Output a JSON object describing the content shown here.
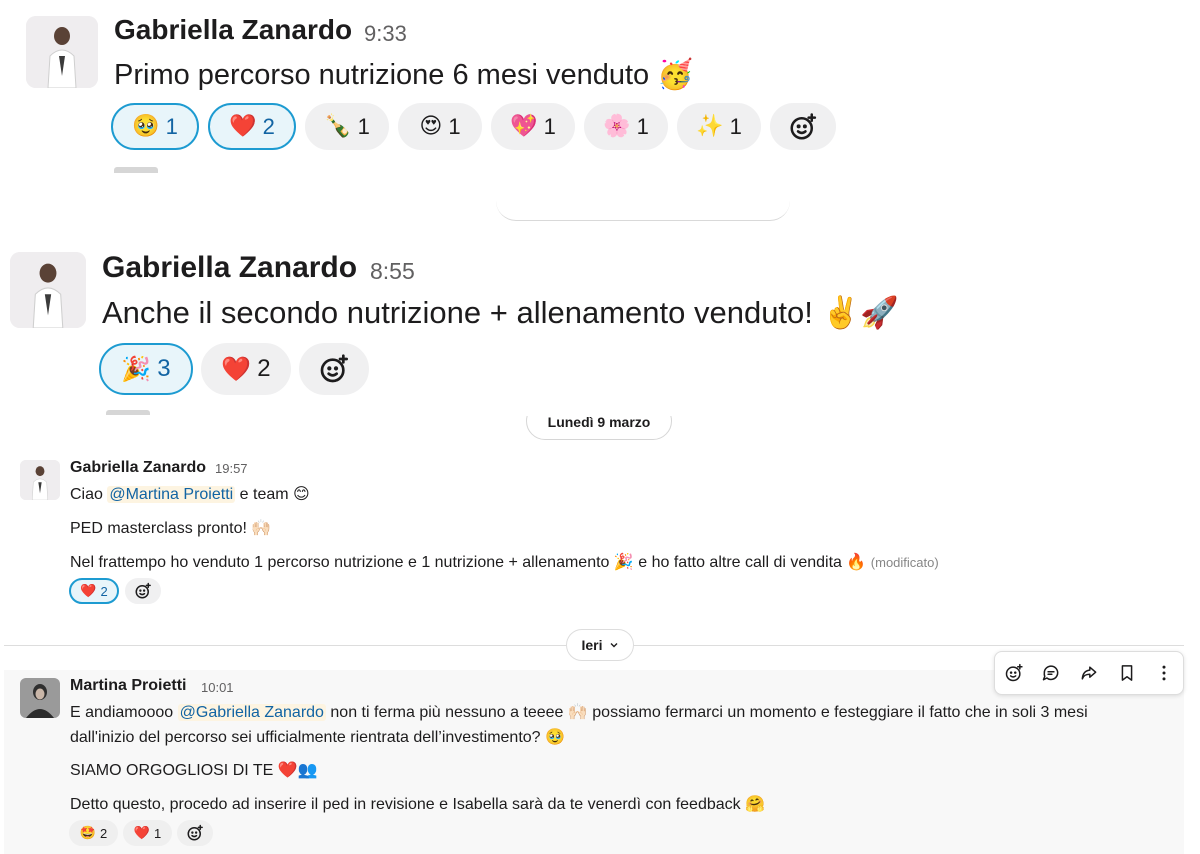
{
  "colors": {
    "accent": "#1264a3",
    "selected_border": "#1d9bd1",
    "selected_bg": "#e8f5fa",
    "reaction_bg": "#f0f0f1",
    "hover_bg": "#f8f8f8"
  },
  "msg1": {
    "author": "Gabriella Zanardo",
    "time": "9:33",
    "text": "Primo percorso nutrizione 6 mesi venduto",
    "emoji": "🥳",
    "reactions": [
      {
        "emoji": "🥹",
        "count": "1",
        "selected": true
      },
      {
        "emoji": "❤️",
        "count": "2",
        "selected": true
      },
      {
        "emoji": "🍾",
        "count": "1",
        "selected": false
      },
      {
        "emoji": "😍",
        "count": "1",
        "selected": false
      },
      {
        "emoji": "💖",
        "count": "1",
        "selected": false
      },
      {
        "emoji": "🌸",
        "count": "1",
        "selected": false
      },
      {
        "emoji": "✨",
        "count": "1",
        "selected": false
      }
    ]
  },
  "msg2": {
    "author": "Gabriella Zanardo",
    "time": "8:55",
    "text": "Anche il secondo nutrizione + allenamento venduto!",
    "emoji": "✌️🚀",
    "reactions": [
      {
        "emoji": "🎉",
        "count": "3",
        "selected": true
      },
      {
        "emoji": "❤️",
        "count": "2",
        "selected": false
      }
    ]
  },
  "date_divider_1": "Lunedì 9 marzo",
  "msg3": {
    "author": "Gabriella Zanardo",
    "time": "19:57",
    "line1_pre": "Ciao",
    "line1_mention": "@Martina Proietti",
    "line1_post": "e team",
    "line1_emoji": "😊",
    "line2": "PED masterclass pronto!",
    "line2_emoji": "🙌🏻",
    "line3_pre": "Nel frattempo ho venduto 1 percorso nutrizione e 1 nutrizione + allenamento",
    "line3_emoji1": "🎉",
    "line3_post": "e ho fatto altre call di vendita",
    "line3_emoji2": "🔥",
    "edited": "(modificato)",
    "reactions": [
      {
        "emoji": "❤️",
        "count": "2",
        "selected": true
      }
    ]
  },
  "date_divider_2": "Ieri",
  "msg4": {
    "author": "Martina Proietti",
    "time": "10:01",
    "line1_pre": "E andiamoooo",
    "line1_mention": "@Gabriella Zanardo",
    "line1_post": "non ti ferma più nessuno a teeee",
    "line1_emoji": "🙌🏻",
    "line1_tail": "possiamo fermarci un momento e festeggiare il fatto che in soli 3 mesi",
    "line2": "dall'inizio del percorso sei ufficialmente rientrata dell’investimento?",
    "line2_emoji": "🥹",
    "line3": "SIAMO ORGOGLIOSI DI TE",
    "line3_emoji": "❤️👥",
    "line4": "Detto questo, procedo ad inserire il ped in revisione e Isabella sarà da te venerdì con feedback",
    "line4_emoji": "🤗",
    "reactions": [
      {
        "emoji": "🤩",
        "count": "2",
        "selected": false
      },
      {
        "emoji": "❤️",
        "count": "1",
        "selected": false
      }
    ]
  },
  "toolbar_icons": [
    "add-reaction-icon",
    "reply-thread-icon",
    "forward-icon",
    "bookmark-icon",
    "more-icon"
  ]
}
